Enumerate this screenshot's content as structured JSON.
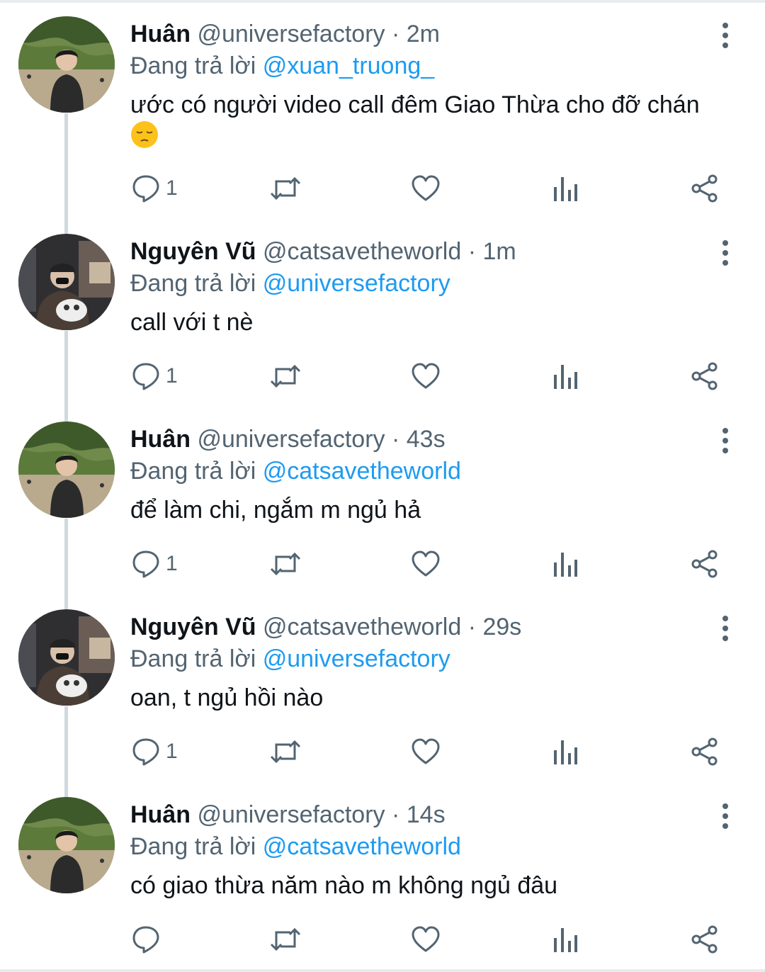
{
  "colors": {
    "text": "#0f1419",
    "muted": "#536471",
    "link": "#1d9bf0",
    "thread_line": "#cfd9de"
  },
  "tweets": [
    {
      "name": "Huân",
      "handle": "@universefactory",
      "time": "2m",
      "reply_prefix": "Đang trả lời",
      "reply_to": "@xuan_truong_",
      "text": "ước có người video call đêm Giao Thừa cho đỡ chán",
      "emoji": "pensive-face-emoji",
      "reply_count": "1",
      "avatar": "huan"
    },
    {
      "name": "Nguyên Vũ",
      "handle": "@catsavetheworld",
      "time": "1m",
      "reply_prefix": "Đang trả lời",
      "reply_to": "@universefactory",
      "text": "call với t nè",
      "reply_count": "1",
      "avatar": "vu"
    },
    {
      "name": "Huân",
      "handle": "@universefactory",
      "time": "43s",
      "reply_prefix": "Đang trả lời",
      "reply_to": "@catsavetheworld",
      "text": "để làm chi, ngắm m ngủ hả",
      "reply_count": "1",
      "avatar": "huan"
    },
    {
      "name": "Nguyên Vũ",
      "handle": "@catsavetheworld",
      "time": "29s",
      "reply_prefix": "Đang trả lời",
      "reply_to": "@universefactory",
      "text": "oan, t ngủ hồi nào",
      "reply_count": "1",
      "avatar": "vu"
    },
    {
      "name": "Huân",
      "handle": "@universefactory",
      "time": "14s",
      "reply_prefix": "Đang trả lời",
      "reply_to": "@catsavetheworld",
      "text": "có giao thừa năm nào m không ngủ đâu",
      "reply_count": "",
      "avatar": "huan"
    }
  ],
  "icons": {
    "reply": "reply-icon",
    "retweet": "retweet-icon",
    "like": "heart-icon",
    "views": "analytics-icon",
    "share": "share-icon",
    "more": "more-options-icon"
  }
}
